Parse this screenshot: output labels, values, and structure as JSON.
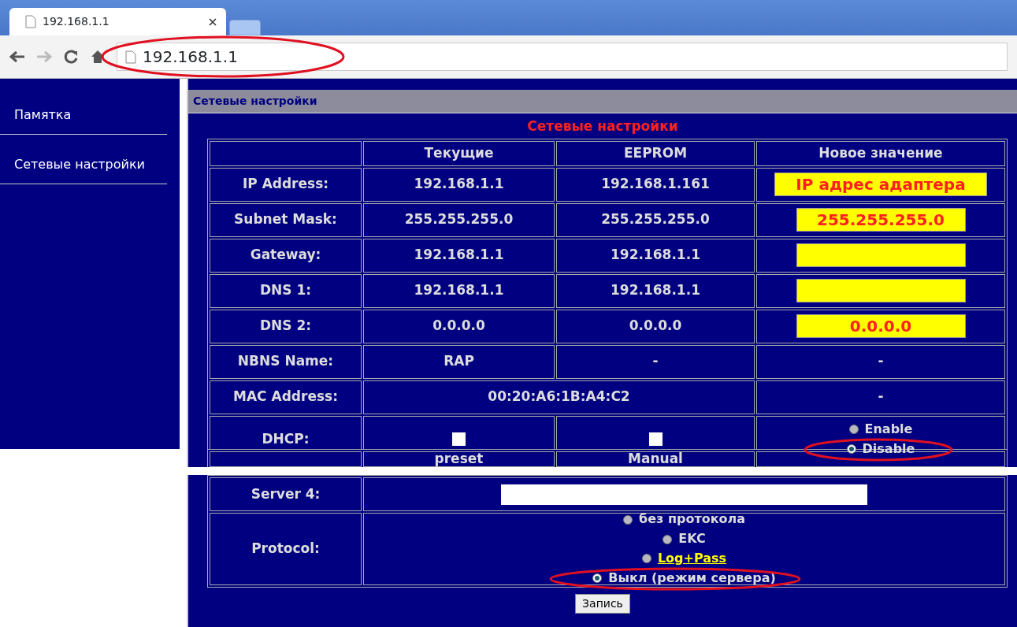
{
  "browser": {
    "tab_title": "192.168.1.1",
    "address": "192.168.1.1",
    "address_circled": true
  },
  "sidebar": {
    "items": [
      {
        "label": "Памятка"
      },
      {
        "label": "Сетевые настройки"
      }
    ]
  },
  "panel": {
    "header": "Сетевые настройки",
    "title": "Сетевые настройки",
    "columns": [
      "Текущие",
      "EEPROM",
      "Новое значение"
    ],
    "rows": [
      {
        "label": "IP Address:",
        "cells": [
          {
            "kind": "text",
            "text": "192.168.1.1"
          },
          {
            "kind": "text",
            "text": "192.168.1.161"
          },
          {
            "kind": "input",
            "value": "IP адрес адаптера"
          }
        ]
      },
      {
        "label": "Subnet Mask:",
        "cells": [
          {
            "kind": "text",
            "text": "255.255.255.0"
          },
          {
            "kind": "text",
            "text": "255.255.255.0"
          },
          {
            "kind": "input",
            "value": "255.255.255.0"
          }
        ]
      },
      {
        "label": "Gateway:",
        "cells": [
          {
            "kind": "text",
            "text": "192.168.1.1"
          },
          {
            "kind": "text",
            "text": "192.168.1.1"
          },
          {
            "kind": "input"
          }
        ]
      },
      {
        "label": "DNS 1:",
        "cells": [
          {
            "kind": "text",
            "text": "192.168.1.1"
          },
          {
            "kind": "text",
            "text": "192.168.1.1"
          },
          {
            "kind": "input"
          }
        ]
      },
      {
        "label": "DNS 2:",
        "cells": [
          {
            "kind": "text",
            "text": "0.0.0.0"
          },
          {
            "kind": "text",
            "text": "0.0.0.0"
          },
          {
            "kind": "input",
            "value": "0.0.0.0"
          }
        ]
      },
      {
        "label": "NBNS Name:",
        "cells": [
          {
            "kind": "text",
            "text": "RAP"
          },
          {
            "kind": "text",
            "text": "-"
          },
          {
            "kind": "text",
            "text": "-"
          }
        ]
      },
      {
        "label": "MAC Address:",
        "cells": [
          {
            "kind": "text",
            "text": "00:20:A6:1B:A4:C2",
            "colspan": 2
          },
          {
            "kind": "text",
            "text": "-"
          }
        ]
      },
      {
        "label": "DHCP:",
        "cells": [
          {
            "kind": "checkbox",
            "checked": false
          },
          {
            "kind": "checkbox",
            "checked": false
          },
          {
            "kind": "radios",
            "options": [
              {
                "label": "Enable",
                "selected": false,
                "circled": false
              },
              {
                "label": "Disable",
                "selected": true,
                "circled": true
              }
            ]
          }
        ]
      }
    ],
    "torn_row": {
      "cells": [
        {
          "kind": "empty"
        },
        {
          "kind": "text",
          "text": "preset"
        },
        {
          "kind": "text",
          "text": "Manual"
        },
        {
          "kind": "empty"
        }
      ]
    },
    "lower_rows": [
      {
        "label": "Server 4:",
        "cells": [
          {
            "kind": "wide_input",
            "colspan": 3
          }
        ]
      },
      {
        "label": "Protocol:",
        "cells": [
          {
            "kind": "radios",
            "colspan": 3,
            "options": [
              {
                "label": "без протокола",
                "selected": false,
                "circled": false
              },
              {
                "label": "EKC",
                "selected": false,
                "circled": false
              },
              {
                "label": "Log+Pass",
                "selected": false,
                "circled": false,
                "link": true
              },
              {
                "label": "Выкл (режим сервера)",
                "selected": true,
                "circled": true
              }
            ]
          }
        ]
      }
    ],
    "save_button": "Запись"
  }
}
